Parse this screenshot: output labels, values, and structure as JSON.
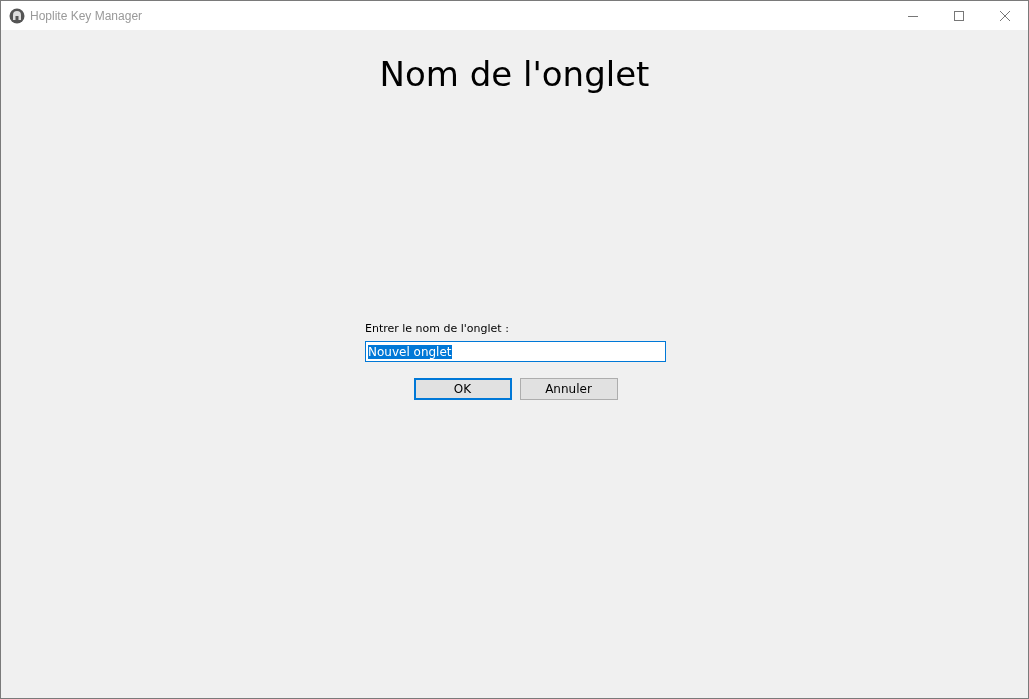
{
  "window": {
    "title": "Hoplite Key Manager"
  },
  "heading": "Nom de l'onglet",
  "prompt": {
    "label": "Entrer le nom de l'onglet :",
    "value": "Nouvel onglet",
    "value_selected": true
  },
  "buttons": [
    {
      "label": "OK",
      "default": true
    },
    {
      "label": "Annuler",
      "default": false
    }
  ]
}
